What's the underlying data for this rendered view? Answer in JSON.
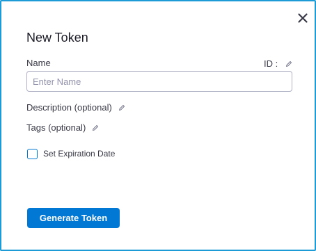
{
  "dialog": {
    "title": "New Token",
    "close_icon": "close-icon",
    "accent_border_color": "#1d9bd7"
  },
  "form": {
    "name_label": "Name",
    "id_label": "ID :",
    "name_placeholder": "Enter Name",
    "name_value": "",
    "description_label": "Description (optional)",
    "tags_label": "Tags (optional)",
    "expiration_label": "Set Expiration Date",
    "expiration_checked": false,
    "edit_icon": "pencil-icon"
  },
  "actions": {
    "generate_label": "Generate Token",
    "primary_color": "#0278d5"
  }
}
